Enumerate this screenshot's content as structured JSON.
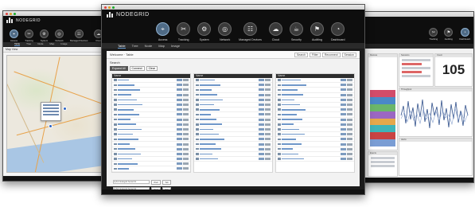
{
  "brand": {
    "name": "NODEGRID"
  },
  "nav": [
    {
      "key": "access",
      "label": "Access",
      "glyph": "⌖"
    },
    {
      "key": "tracking",
      "label": "Tracking",
      "glyph": "✂"
    },
    {
      "key": "system",
      "label": "System",
      "glyph": "⚙"
    },
    {
      "key": "network",
      "label": "Network",
      "glyph": "◎"
    },
    {
      "key": "managed",
      "label": "Managed Devices",
      "glyph": "☷"
    },
    {
      "key": "cloud",
      "label": "Cloud",
      "glyph": "☁"
    },
    {
      "key": "security",
      "label": "Security",
      "glyph": "☕"
    },
    {
      "key": "auditing",
      "label": "Auditing",
      "glyph": "⚑"
    },
    {
      "key": "dashboard",
      "label": "Dashboard",
      "glyph": "◔"
    }
  ],
  "right_nav": [
    {
      "key": "tracking",
      "label": "Tracking",
      "glyph": "✂"
    },
    {
      "key": "auditing",
      "label": "Auditing",
      "glyph": "⚑"
    },
    {
      "key": "dashboard",
      "label": "Dashboard",
      "glyph": "◔"
    }
  ],
  "main": {
    "subnav": [
      "Table",
      "Tree",
      "Node",
      "Map",
      "Image"
    ],
    "toolbar_title": "Welcome · Table",
    "toolbar_buttons": [
      "Search",
      "Filter",
      "Reconnect",
      "Session"
    ],
    "breadcrumb": "Search",
    "chips": [
      "Expand All",
      "Connect",
      "Clear"
    ],
    "column_headers": [
      "Name",
      "Name",
      "Name"
    ],
    "footer_rows": [
      {
        "label": "ttyS1 Nodegrid Serial 01",
        "buttons": [
          "Web",
          "Tab"
        ]
      },
      {
        "label": "ttyS2 Nodegrid Serial 02",
        "buttons": [
          "Web",
          "Tab"
        ]
      }
    ]
  },
  "left": {
    "subnav": [
      "Table",
      "Tree",
      "Node",
      "Map",
      "Image"
    ],
    "header": "Map View"
  },
  "right": {
    "big_number": "105",
    "widgets": [
      "Devices",
      "Sessions",
      "Alerts",
      "Count",
      "Throughput",
      "Events"
    ]
  }
}
